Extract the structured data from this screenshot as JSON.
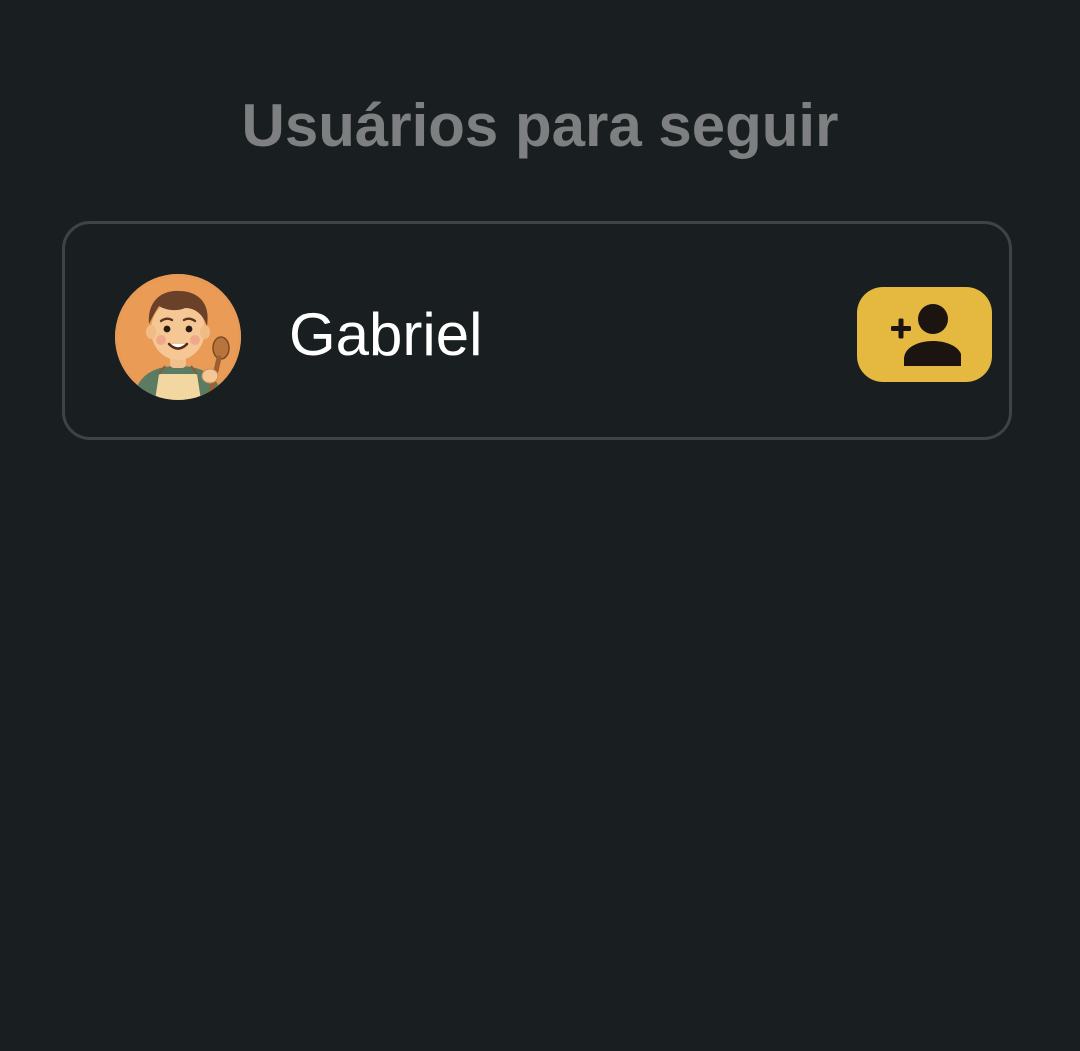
{
  "header": {
    "title": "Usuários para seguir"
  },
  "users": [
    {
      "name": "Gabriel",
      "avatar_icon": "chef-avatar",
      "follow_icon": "person-add-icon"
    }
  ],
  "colors": {
    "background": "#191f21",
    "title_text": "#7d7f80",
    "card_border": "#3d4446",
    "name_text": "#ffffff",
    "accent": "#e5b83f",
    "icon_dark": "#1b1410"
  }
}
